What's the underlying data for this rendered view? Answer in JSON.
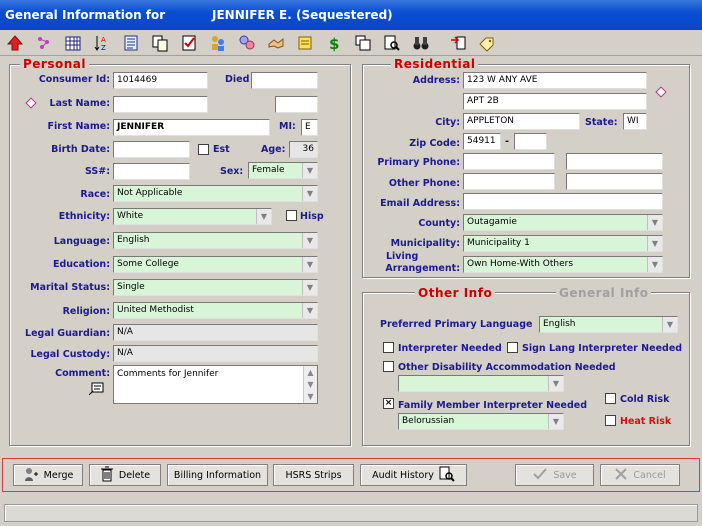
{
  "window": {
    "title_prefix": "General Information for",
    "title_name": "JENNIFER E. (Sequestered)"
  },
  "toolbar": {
    "icons": [
      "up-arrow-icon",
      "scatter-icon",
      "calendar-grid-icon",
      "sort-icon",
      "document-lines-icon",
      "copy-document-icon",
      "checklist-icon",
      "people-icon",
      "group-icon",
      "handshake-icon",
      "note-icon",
      "dollar-icon",
      "duplicate-icon",
      "search-document-icon",
      "binoculars-icon",
      "import-icon",
      "pencil-tag-icon"
    ]
  },
  "personal": {
    "legend": "Personal",
    "consumer_id_label": "Consumer Id",
    "consumer_id": "1014469",
    "died_label": "Died",
    "died": "",
    "last_name_label": "Last Name",
    "last_name": "",
    "last_name_suffix": "",
    "first_name_label": "First Name",
    "first_name": "JENNIFER",
    "mi_label": "MI",
    "mi": "E",
    "birth_date_label": "Birth Date",
    "birth_date": "",
    "est_label": "Est",
    "age_label": "Age",
    "age": "36",
    "ssn_label": "SS#",
    "ssn": "",
    "sex_label": "Sex",
    "sex": "Female",
    "race_label": "Race",
    "race": "Not Applicable",
    "ethnicity_label": "Ethnicity",
    "ethnicity": "White",
    "hisp_label": "Hisp",
    "language_label": "Language",
    "language": "English",
    "education_label": "Education",
    "education": "Some College",
    "marital_label": "Marital Status",
    "marital": "Single",
    "religion_label": "Religion",
    "religion": "United Methodist",
    "guardian_label": "Legal Guardian",
    "guardian": "N/A",
    "custody_label": "Legal Custody",
    "custody": "N/A",
    "comment_label": "Comment",
    "comment": "Comments for Jennifer"
  },
  "residential": {
    "legend": "Residential",
    "address_label": "Address",
    "address1": "123 W ANY AVE",
    "address2": "APT 2B",
    "city_label": "City",
    "city": "APPLETON",
    "state_label": "State",
    "state": "WI",
    "zip_label": "Zip Code",
    "zip": "54911",
    "zip_ext": "",
    "zip_sep": "-",
    "primary_phone_label": "Primary Phone",
    "other_phone_label": "Other Phone",
    "email_label": "Email Address",
    "county_label": "County",
    "county": "Outagamie",
    "municipality_label": "Municipality",
    "municipality": "Municipality 1",
    "living_label_1": "Living",
    "living_label_2": "Arrangement",
    "living": "Own Home-With Others"
  },
  "other": {
    "tab_other": "Other Info",
    "tab_general": "General Info",
    "pref_lang_label": "Preferred Primary Language",
    "pref_lang": "English",
    "interpreter_label": "Interpreter Needed",
    "sign_lang_label": "Sign Lang Interpreter Needed",
    "other_disability_label": "Other Disability Accommodation Needed",
    "family_interp_label": "Family Member Interpreter Needed",
    "family_interp_checked": "×",
    "family_language": "Belorussian",
    "cold_risk_label": "Cold Risk",
    "heat_risk_label": "Heat Risk"
  },
  "buttons": {
    "merge": "Merge",
    "delete": "Delete",
    "billing": "Billing Information",
    "hsrs": "HSRS Strips",
    "audit": "Audit History",
    "save": "Save",
    "cancel": "Cancel"
  },
  "colors": {
    "title_bar": "#0a4ed4",
    "label_blue": "#1b1b8f",
    "legend_red": "#cc0000",
    "dropdown_green": "#d8f5d8"
  }
}
